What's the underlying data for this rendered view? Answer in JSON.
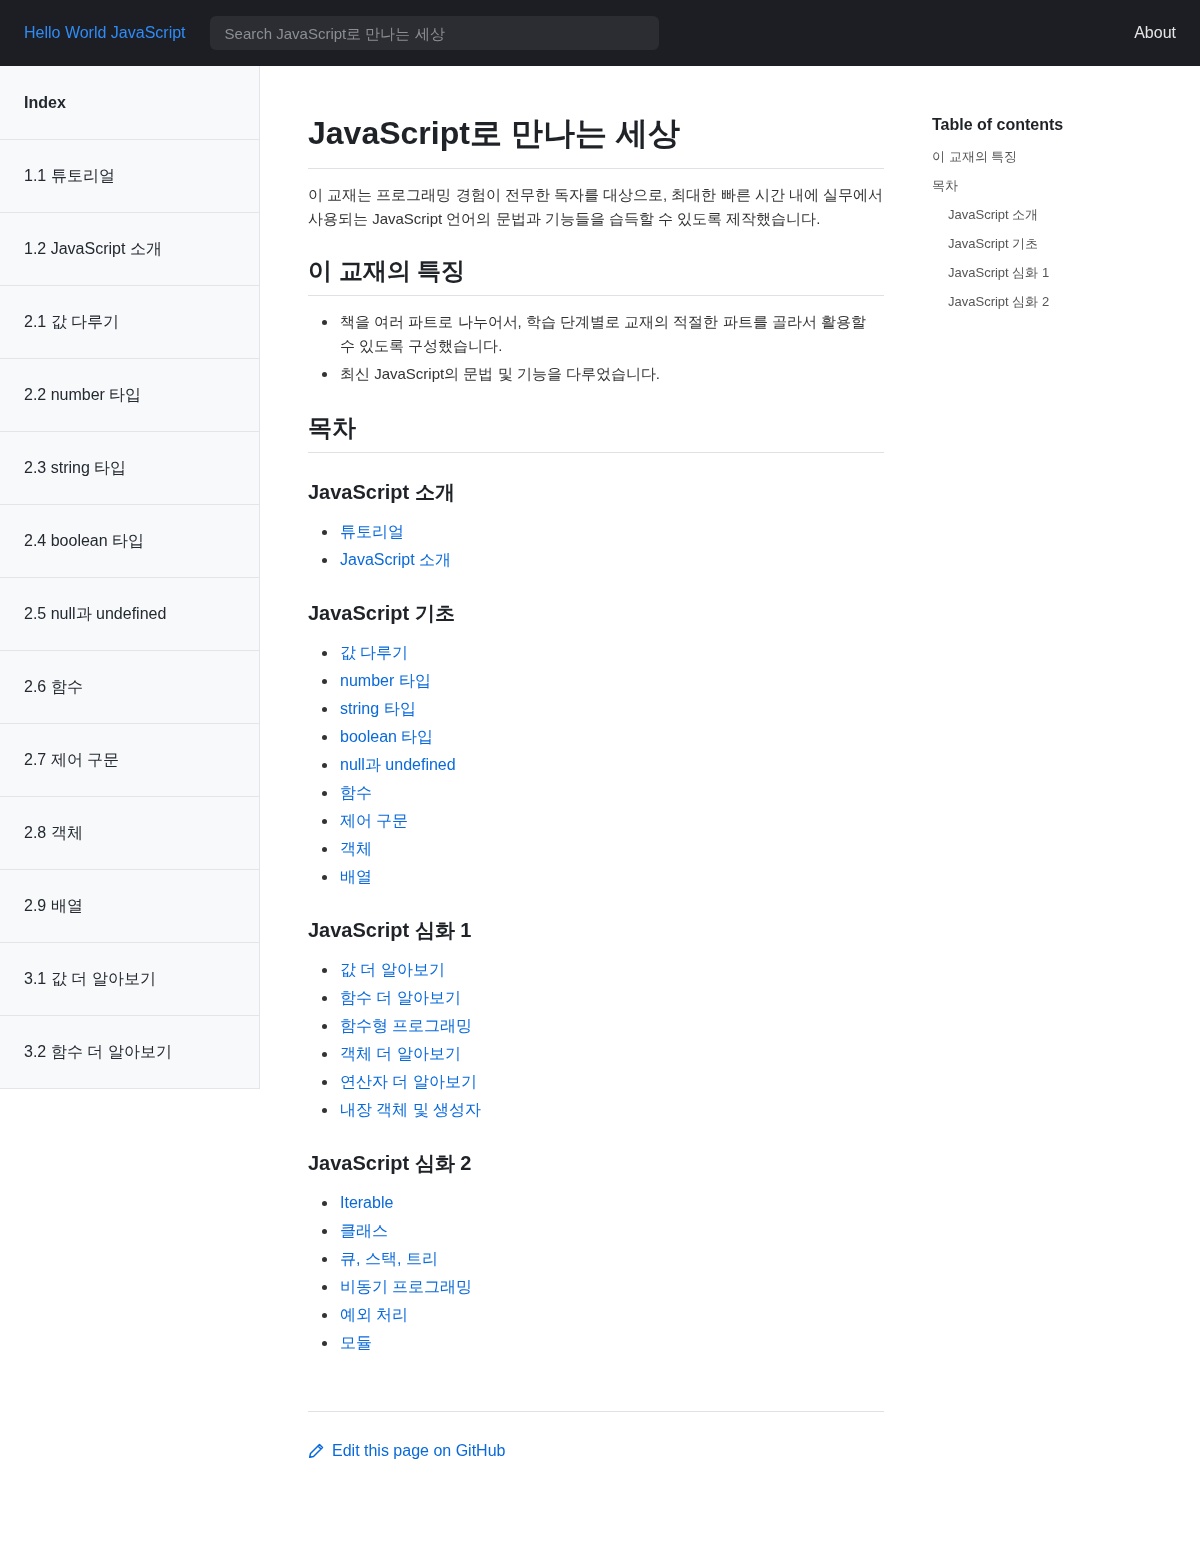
{
  "header": {
    "brand": "Hello World JavaScript",
    "search": {
      "placeholder": "Search JavaScript로 만나는 세상"
    },
    "nav": [
      "About"
    ]
  },
  "sidebar": {
    "items": [
      {
        "label": "Index",
        "kind": "heading"
      },
      {
        "label": "1.1 튜토리얼",
        "kind": "link"
      },
      {
        "label": "1.2 JavaScript 소개",
        "kind": "link"
      },
      {
        "label": "2.1 값 다루기",
        "kind": "link"
      },
      {
        "label": "2.2 number 타입",
        "kind": "link"
      },
      {
        "label": "2.3 string 타입",
        "kind": "link"
      },
      {
        "label": "2.4 boolean 타입",
        "kind": "link"
      },
      {
        "label": "2.5 null과 undefined",
        "kind": "link"
      },
      {
        "label": "2.6 함수",
        "kind": "link"
      },
      {
        "label": "2.7 제어 구문",
        "kind": "link"
      },
      {
        "label": "2.8 객체",
        "kind": "link"
      },
      {
        "label": "2.9 배열",
        "kind": "link"
      },
      {
        "label": "3.1 값 더 알아보기",
        "kind": "link"
      },
      {
        "label": "3.2 함수 더 알아보기",
        "kind": "link"
      }
    ]
  },
  "article": {
    "title": "JavaScript로 만나는 세상",
    "intro": "이 교재는 프로그래밍 경험이 전무한 독자를 대상으로, 최대한 빠른 시간 내에 실무에서 사용되는 JavaScript 언어의 문법과 기능들을 습득할 수 있도록 제작했습니다.",
    "sections": [
      {
        "heading": "이 교재의 특징",
        "bullets": [
          "책을 여러 파트로 나누어서, 학습 단계별로 교재의 적절한 파트를 골라서 활용할 수 있도록 구성했습니다.",
          "최신 JavaScript의 문법 및 기능을 다루었습니다."
        ]
      },
      {
        "heading": "목차",
        "subsections": [
          {
            "heading": "JavaScript 소개",
            "links": [
              "튜토리얼",
              "JavaScript 소개"
            ]
          },
          {
            "heading": "JavaScript 기초",
            "links": [
              "값 다루기",
              "number 타입",
              "string 타입",
              "boolean 타입",
              "null과 undefined",
              "함수",
              "제어 구문",
              "객체",
              "배열"
            ]
          },
          {
            "heading": "JavaScript 심화 1",
            "links": [
              "값 더 알아보기",
              "함수 더 알아보기",
              "함수형 프로그래밍",
              "객체 더 알아보기",
              "연산자 더 알아보기",
              "내장 객체 및 생성자"
            ]
          },
          {
            "heading": "JavaScript 심화 2",
            "links": [
              "Iterable",
              "클래스",
              "큐, 스택, 트리",
              "비동기 프로그래밍",
              "예외 처리",
              "모듈"
            ]
          }
        ]
      }
    ],
    "edit_link": "Edit this page on GitHub"
  },
  "toc": {
    "title": "Table of contents",
    "items": [
      {
        "label": "이 교재의 특징"
      },
      {
        "label": "목차",
        "children": [
          {
            "label": "JavaScript 소개"
          },
          {
            "label": "JavaScript 기초"
          },
          {
            "label": "JavaScript 심화 1"
          },
          {
            "label": "JavaScript 심화 2"
          }
        ]
      }
    ]
  }
}
